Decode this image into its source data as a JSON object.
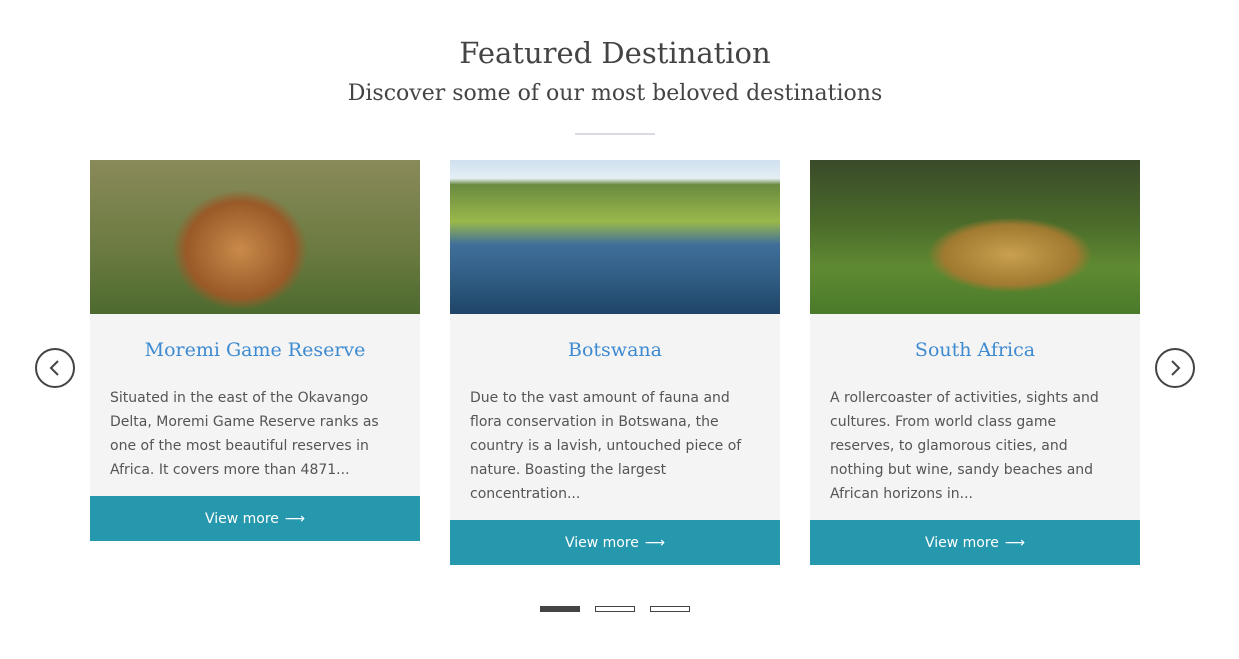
{
  "header": {
    "title": "Featured Destination",
    "subtitle": "Discover some of our most beloved destinations"
  },
  "cards": [
    {
      "title": "Moremi Game Reserve",
      "text": "Situated in the east of the Okavango Delta, Moremi Game Reserve ranks as one of the most beautiful reserves in Africa. It covers more than 4871...",
      "button": "View more",
      "image": "lion"
    },
    {
      "title": "Botswana",
      "text": "Due to the vast amount of fauna and flora conservation in Botswana, the country is a lavish, untouched piece of nature. Boasting the largest concentration...",
      "button": "View more",
      "image": "elephants-in-river"
    },
    {
      "title": "South Africa",
      "text": "A rollercoaster of activities, sights and cultures. From world class game reserves, to glamorous cities, and nothing but wine, sandy beaches and African horizons in...",
      "button": "View more",
      "image": "leopard-safari"
    }
  ],
  "carousel": {
    "active_page": 1,
    "total_pages": 3
  },
  "colors": {
    "accent": "#2698ad",
    "title": "#3d8ad1"
  }
}
